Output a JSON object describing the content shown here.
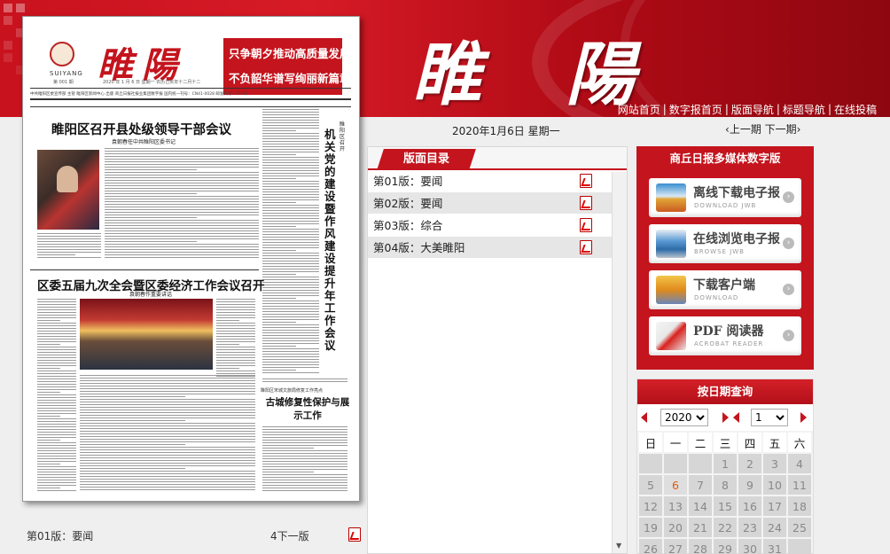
{
  "header": {
    "masthead": "睢 陽",
    "nav": [
      "网站首页",
      "数字报首页",
      "版面导航",
      "标题导航",
      "在线投稿"
    ]
  },
  "paper": {
    "name": "睢陽",
    "seal_text": "SUIYANG",
    "issue_no": "第 001 期",
    "slogan_lines": [
      "只争朝夕推动高质量发展",
      "不负韶华谱写绚丽新篇章"
    ],
    "dateline": "2020 年 1 月 6 日  星期一  农历己亥年十二月十二",
    "infoline": "中共睢阳区委宣传部 主管   睢阳区新闻中心 出版   商丘日报社报业集团数字报   国内统一刊号：CN41-0028   邮发代号：35-36",
    "headline1": "睢阳区召开县处级领导干部会议",
    "headline1_sub": "袁朝春任中共睢阳区委书记",
    "headline2": "区委五届九次全会暨区委经济工作会议召开",
    "headline2_sub": "袁朝春作重要讲话",
    "vertical_headline": "机关党的建设暨作风建设提升年工作会议",
    "vertical_small": "睢阳区召开",
    "headline3_pre": "睢阳区宋城文旅局修复工作亮点",
    "headline3": "古城修复性保护与展示工作",
    "page_label": "第01版：要闻",
    "next_label": "4下一版"
  },
  "main": {
    "date": "2020年1月6日 星期一",
    "prev": "上一期",
    "next": "下一期",
    "toc_title": "版面目录",
    "toc_items": [
      "第01版：要闻",
      "第02版：要闻",
      "第03版：综合",
      "第04版：大美睢阳"
    ]
  },
  "media": {
    "title": "商丘日报多媒体数字版",
    "items": [
      {
        "title": "离线下载电子报",
        "sub": "DOWNLOAD JWB",
        "icon": "book-stack-icon"
      },
      {
        "title": "在线浏览电子报",
        "sub": "BROWSE JWB",
        "icon": "monitor-icon"
      },
      {
        "title": "下载客户端",
        "sub": "DOWNLOAD",
        "icon": "client-icon"
      },
      {
        "title": "PDF 阅读器",
        "sub": "ACROBAT READER",
        "icon": "acrobat-icon"
      }
    ]
  },
  "calendar": {
    "title": "按日期查询",
    "year": "2020",
    "month": "1",
    "weekdays": [
      "日",
      "一",
      "二",
      "三",
      "四",
      "五",
      "六"
    ],
    "rows": [
      [
        "",
        "",
        "",
        "1",
        "2",
        "3",
        "4"
      ],
      [
        "5",
        "6",
        "7",
        "8",
        "9",
        "10",
        "11"
      ],
      [
        "12",
        "13",
        "14",
        "15",
        "16",
        "17",
        "18"
      ],
      [
        "19",
        "20",
        "21",
        "22",
        "23",
        "24",
        "25"
      ],
      [
        "26",
        "27",
        "28",
        "29",
        "30",
        "31",
        ""
      ]
    ],
    "today": "6",
    "colors": {
      "accent": "#c4141d",
      "today": "#e05a1a"
    }
  }
}
